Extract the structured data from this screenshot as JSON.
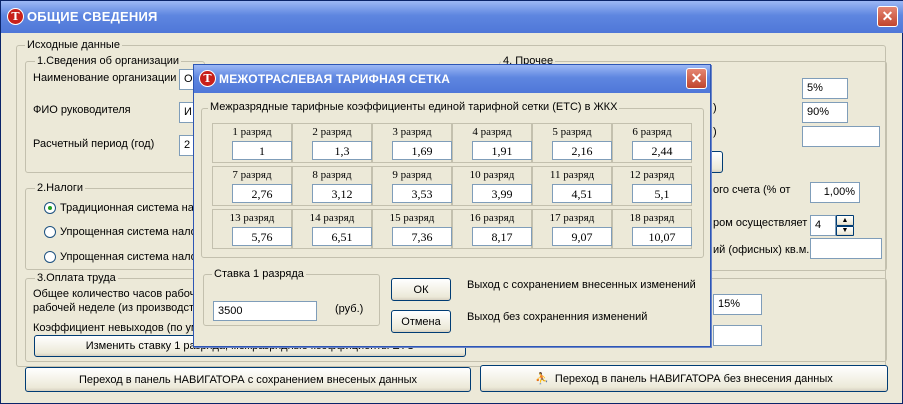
{
  "main": {
    "title": "ОБЩИЕ СВЕДЕНИЯ",
    "source_group": "Исходные данные",
    "org": {
      "legend": "1.Сведения об организации",
      "name_label": "Наименование организации",
      "name_value": "О",
      "director_label": "ФИО руководителя",
      "director_value": "И",
      "period_label": "Расчетный  период (год)",
      "period_value": "2"
    },
    "taxes": {
      "legend": "2.Налоги",
      "options": [
        "Традиционная система нал",
        "Упрощенная система нало",
        "Упрощенная система нало"
      ]
    },
    "labor": {
      "legend": "3.Оплата труда",
      "hours_label_1": "Общее количество часов рабоч",
      "hours_label_2": "рабочей неделе (из производст",
      "absence_label": "Коэффициент невыходов (по ум",
      "rate_button": "Изменить ставку 1 разряда, межразрядные коэффициенты ЕТС",
      "pct_value": "15%"
    },
    "other": {
      "legend": "4. Прочее",
      "field1": "5%",
      "field2": "90%",
      "paren2": ")",
      "paren3": ")",
      "field3": "",
      "account_label": "ого счета (% от",
      "account_value": "1,00%",
      "implement_label": "ром осуществляет",
      "spinner_value": "4",
      "office_label": "ий (офисных) кв.м.",
      "office_value": ""
    },
    "buttons": {
      "nav_save": "Переход в панель НАВИГАТОРА с сохранением внесеных данных",
      "nav_nosave": "Переход в панель НАВИГАТОРА  без  внесения данных"
    }
  },
  "dialog": {
    "title": "МЕЖОТРАСЛЕВАЯ ТАРИФНАЯ СЕТКА",
    "group_legend": "Межразрядные тарифные коэффициенты единой тарифной сетки (ЕТС) в ЖКХ",
    "grades": [
      {
        "label": "1 разряд",
        "value": "1"
      },
      {
        "label": "2 разряд",
        "value": "1,3"
      },
      {
        "label": "3 разряд",
        "value": "1,69"
      },
      {
        "label": "4 разряд",
        "value": "1,91"
      },
      {
        "label": "5 разряд",
        "value": "2,16"
      },
      {
        "label": "6 разряд",
        "value": "2,44"
      },
      {
        "label": "7 разряд",
        "value": "2,76"
      },
      {
        "label": "8 разряд",
        "value": "3,12"
      },
      {
        "label": "9 разряд",
        "value": "3,53"
      },
      {
        "label": "10 разряд",
        "value": "3,99"
      },
      {
        "label": "11 разряд",
        "value": "4,51"
      },
      {
        "label": "12 разряд",
        "value": "5,1"
      },
      {
        "label": "13 разряд",
        "value": "5,76"
      },
      {
        "label": "14 разряд",
        "value": "6,51"
      },
      {
        "label": "15 разряд",
        "value": "7,36"
      },
      {
        "label": "16 разряд",
        "value": "8,17"
      },
      {
        "label": "17 разряд",
        "value": "9,07"
      },
      {
        "label": "18 разряд",
        "value": "10,07"
      }
    ],
    "rate_legend": "Ставка 1 разряда",
    "rate_value": "3500",
    "rate_unit": "(руб.)",
    "ok_label": "ОК",
    "cancel_label": "Отмена",
    "ok_desc": "Выход с сохранением внесенных изменений",
    "cancel_desc": "Выход без сохраненния изменений"
  },
  "colors": {
    "titlebar": "#4f77d8",
    "window_bg": "#ece9d8",
    "close_button": "#c0452e",
    "app_icon": "#c8201a"
  }
}
